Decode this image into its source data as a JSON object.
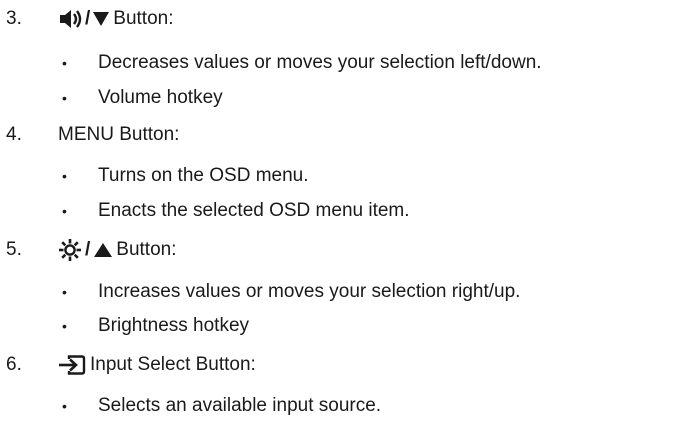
{
  "items": [
    {
      "number": "3.",
      "title": "Button:",
      "icons": [
        "volume-icon",
        "triangle-down-icon"
      ],
      "bullets": [
        "Decreases values or moves your selection left/down.",
        "Volume hotkey"
      ]
    },
    {
      "number": "4.",
      "title": "MENU Button:",
      "icons": [],
      "bullets": [
        "Turns on the OSD menu.",
        "Enacts the selected OSD menu item."
      ]
    },
    {
      "number": "5.",
      "title": "Button:",
      "icons": [
        "brightness-icon",
        "triangle-up-icon"
      ],
      "bullets": [
        "Increases values or moves your selection right/up.",
        "Brightness hotkey"
      ]
    },
    {
      "number": "6.",
      "title": "Input Select Button:",
      "icons": [
        "input-select-icon"
      ],
      "bullets": [
        "Selects an available input source."
      ]
    }
  ],
  "bullet_char": "•",
  "slash": "/"
}
